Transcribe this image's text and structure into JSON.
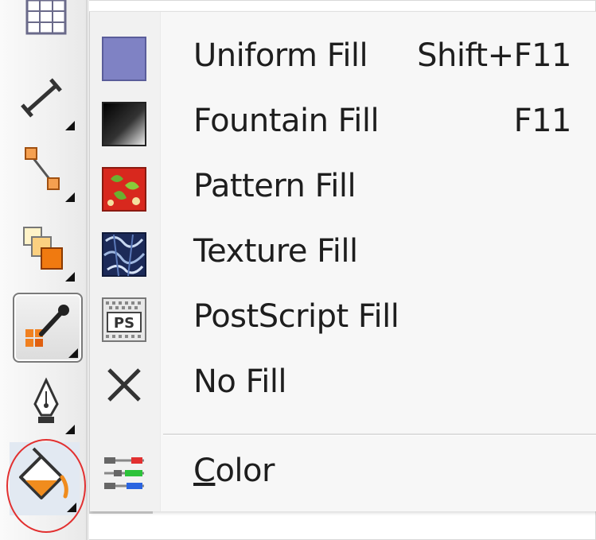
{
  "toolbox": {
    "tools": [
      {
        "name": "table-tool",
        "icon": "table-grid-icon",
        "has_flyout": false
      },
      {
        "name": "dimension-tool",
        "icon": "dimension-line-icon",
        "has_flyout": true
      },
      {
        "name": "connector-tool",
        "icon": "connector-icon",
        "has_flyout": true
      },
      {
        "name": "blend-tool",
        "icon": "blend-squares-icon",
        "has_flyout": true
      },
      {
        "name": "eyedropper-tool",
        "icon": "eyedropper-icon",
        "has_flyout": true,
        "state": "active"
      },
      {
        "name": "outline-pen-tool",
        "icon": "pen-nib-icon",
        "has_flyout": true
      },
      {
        "name": "fill-tool",
        "icon": "paint-bucket-icon",
        "has_flyout": true,
        "state": "highlighted"
      }
    ]
  },
  "fill_menu": {
    "items": [
      {
        "label": "Uniform Fill",
        "shortcut": "Shift+F11",
        "icon": "uniform-fill-icon"
      },
      {
        "label": "Fountain Fill",
        "shortcut": "F11",
        "icon": "fountain-fill-icon"
      },
      {
        "label": "Pattern Fill",
        "shortcut": "",
        "icon": "pattern-fill-icon"
      },
      {
        "label": "Texture Fill",
        "shortcut": "",
        "icon": "texture-fill-icon"
      },
      {
        "label": "PostScript Fill",
        "shortcut": "",
        "icon": "postscript-fill-icon",
        "icon_text": "PS"
      },
      {
        "label": "No Fill",
        "shortcut": "",
        "icon": "no-fill-x-icon"
      }
    ],
    "color_item": {
      "label": "Color",
      "icon": "color-sliders-icon"
    }
  },
  "colors": {
    "uniform_fill": "#7f82c4",
    "highlight_circle": "#e23030",
    "fill_tool_orange": "#f08c1e"
  }
}
